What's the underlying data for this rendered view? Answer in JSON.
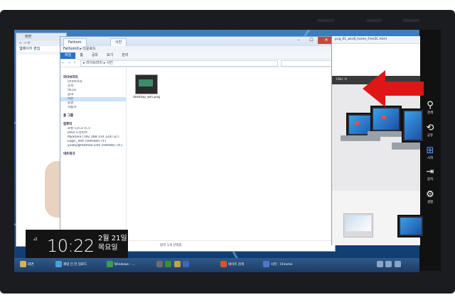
{
  "colors": {
    "accent": "#2a72c6",
    "arrow": "#e01515",
    "charm_bg": "#111111",
    "taskbar": "#1d3c63"
  },
  "left_window": {
    "title": "화면",
    "tab": "웹페이지 편집"
  },
  "explorer": {
    "tabs": [
      "Fathom",
      "사진"
    ],
    "breadcrumb_top": "Fathom0 ▸ 다운로드",
    "ribbon": [
      "파일",
      "홈",
      "공유",
      "보기",
      "관리"
    ],
    "nav_buttons": [
      "←",
      "→",
      "↑"
    ],
    "path": "▸ 라이브러리 ▸ 사진",
    "nav_groups": [
      {
        "head": "라이브러리",
        "items": [
          "라이브러리",
          "문서",
          "비디오",
          "음악",
          "사진",
          "동영",
          "사용자"
        ],
        "selected": 4
      },
      {
        "head": "홈 그룹",
        "items": []
      },
      {
        "head": "컴퓨터",
        "items": [
          "로컬 디스크 (C:)",
          "DVD 드라이브",
          "MyShare (192.168.110.124) (Z:)",
          "Logic_Test (\\netdisk) (Y:)",
          "yuxby@hotmail.com (netdisk) (X:)"
        ]
      },
      {
        "head": "네트워크",
        "items": []
      }
    ],
    "file": {
      "name": "desktop_win.png"
    },
    "status": "항목 1개 선택함"
  },
  "right_browser": {
    "url": "pcg_01_win8_home_Fres5C.html",
    "tabbar": "ENU 서"
  },
  "charms": [
    {
      "icon": "search-icon",
      "glyph": "⚲",
      "label": "검색"
    },
    {
      "icon": "share-icon",
      "glyph": "⟲",
      "label": "공유"
    },
    {
      "icon": "windows-start-icon",
      "glyph": "⊞",
      "label": "시작"
    },
    {
      "icon": "devices-icon",
      "glyph": "⇥",
      "label": "장치"
    },
    {
      "icon": "settings-icon",
      "glyph": "⚙",
      "label": "설정"
    }
  ],
  "clock": {
    "indicator": "⊿",
    "time": "10:22",
    "date": "2월 21일",
    "weekday": "목요일"
  },
  "taskbar": {
    "items": [
      {
        "label": "화면",
        "color": "#d2b25a"
      },
      {
        "label": "재업 인 전 업로드",
        "color": "#4ba0e0"
      },
      {
        "label": "Windows - ...",
        "color": "#3aa04b"
      },
      {
        "label": "네이트 검색",
        "color": "#d8532c"
      },
      {
        "label": "사진 - Chrome",
        "color": "#4f78c8"
      }
    ]
  }
}
